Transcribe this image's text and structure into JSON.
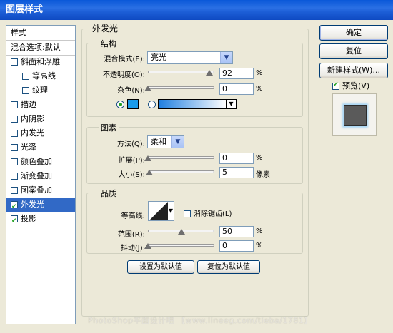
{
  "window": {
    "title": "图层样式"
  },
  "sidebar": {
    "header": "样式",
    "items": [
      {
        "label": "混合选项:默认",
        "check": "none"
      },
      {
        "label": "斜面和浮雕",
        "check": "unchecked"
      },
      {
        "label": "等高线",
        "check": "unchecked",
        "indent": true
      },
      {
        "label": "纹理",
        "check": "unchecked",
        "indent": true
      },
      {
        "label": "描边",
        "check": "unchecked"
      },
      {
        "label": "内阴影",
        "check": "unchecked"
      },
      {
        "label": "内发光",
        "check": "unchecked"
      },
      {
        "label": "光泽",
        "check": "unchecked"
      },
      {
        "label": "颜色叠加",
        "check": "unchecked"
      },
      {
        "label": "渐变叠加",
        "check": "unchecked"
      },
      {
        "label": "图案叠加",
        "check": "unchecked"
      },
      {
        "label": "外发光",
        "check": "checked",
        "selected": true
      },
      {
        "label": "投影",
        "check": "checked"
      }
    ]
  },
  "panel": {
    "title": "外发光"
  },
  "structure": {
    "legend": "结构",
    "blend_mode_label": "混合模式(E):",
    "blend_mode_value": "亮光",
    "opacity_label": "不透明度(O):",
    "opacity_value": "92",
    "opacity_level": 0.92,
    "noise_label": "杂色(N):",
    "noise_value": "0",
    "noise_level": 0,
    "unit": "%",
    "color_swatch": "#1a9bea",
    "gradient_from": "#1f7fe0",
    "gradient_to": "#ffffff"
  },
  "elements": {
    "legend": "图素",
    "method_label": "方法(Q):",
    "method_value": "柔和",
    "spread_label": "扩展(P):",
    "spread_value": "0",
    "spread_level": 0,
    "spread_unit": "%",
    "size_label": "大小(S):",
    "size_value": "5",
    "size_level": 0.02,
    "size_unit": "像素"
  },
  "quality": {
    "legend": "品质",
    "contour_label": "等高线:",
    "antialias_label": "消除锯齿(L)",
    "range_label": "范围(R):",
    "range_value": "50",
    "range_level": 0.5,
    "range_unit": "%",
    "jitter_label": "抖动(J):",
    "jitter_value": "0",
    "jitter_level": 0,
    "jitter_unit": "%"
  },
  "footer": {
    "set_default": "设置为默认值",
    "reset_default": "复位为默认值"
  },
  "buttons": {
    "ok": "确定",
    "reset": "复位",
    "new_style": "新建样式(W)...",
    "preview": "预览(V)"
  },
  "watermark": "PhotoShop平面设计吧 【www.lineeg.com/tieba/1781】"
}
